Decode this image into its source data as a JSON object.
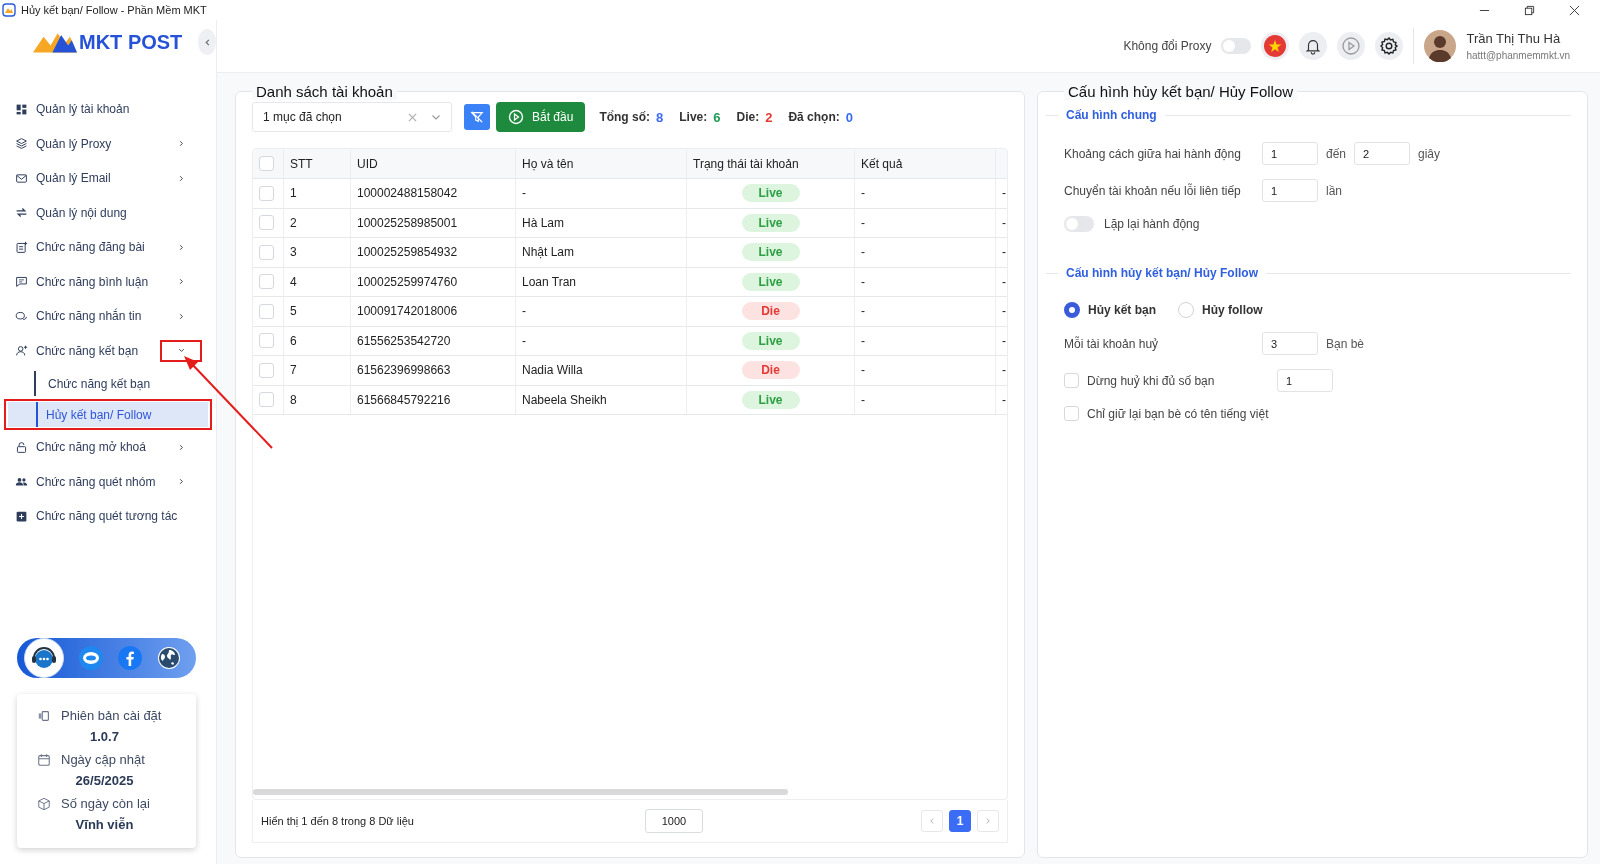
{
  "window": {
    "title": "Hủy kết bạn/ Follow - Phần Mềm MKT"
  },
  "logo": {
    "text": "MKT POST"
  },
  "sidebar": {
    "items": [
      {
        "label": "Quản lý tài khoản",
        "has_submenu": false
      },
      {
        "label": "Quản lý Proxy",
        "has_submenu": true,
        "expanded": false
      },
      {
        "label": "Quản lý Email",
        "has_submenu": true,
        "expanded": false
      },
      {
        "label": "Quản lý nội dung",
        "has_submenu": false
      },
      {
        "label": "Chức năng đăng bài",
        "has_submenu": true,
        "expanded": false
      },
      {
        "label": "Chức năng bình luận",
        "has_submenu": true,
        "expanded": false
      },
      {
        "label": "Chức năng nhắn tin",
        "has_submenu": true,
        "expanded": false
      },
      {
        "label": "Chức năng kết bạn",
        "has_submenu": true,
        "expanded": true,
        "caret_highlighted": true,
        "children": [
          {
            "label": "Chức năng kết bạn",
            "selected": false,
            "highlighted": false
          },
          {
            "label": "Hủy kết bạn/ Follow",
            "selected": true,
            "highlighted": true
          }
        ]
      },
      {
        "label": "Chức năng mở khoá",
        "has_submenu": true,
        "expanded": false
      },
      {
        "label": "Chức năng quét nhóm",
        "has_submenu": true,
        "expanded": false
      },
      {
        "label": "Chức năng quét tương tác",
        "has_submenu": false
      }
    ]
  },
  "annotation_arrow": true,
  "info_card": {
    "items": [
      {
        "label": "Phiên bản cài đặt",
        "value": "1.0.7"
      },
      {
        "label": "Ngày cập nhật",
        "value": "26/5/2025"
      },
      {
        "label": "Số ngày còn lại",
        "value": "Vĩnh viễn"
      }
    ]
  },
  "header": {
    "proxy_toggle": {
      "label": "Không đổi Proxy",
      "on": false
    },
    "user": {
      "name": "Trần Thị Thu Hà",
      "email": "hattt@phanmemmkt.vn"
    }
  },
  "accounts_panel": {
    "title": "Danh sách tài khoản",
    "select": {
      "value": "1 mục đã chọn"
    },
    "start_button": "Bắt đầu",
    "stats": [
      {
        "label": "Tổng số:",
        "value": "8",
        "color": "#3b6cf6"
      },
      {
        "label": "Live:",
        "value": "6",
        "color": "#1f9d55"
      },
      {
        "label": "Die:",
        "value": "2",
        "color": "#e53935"
      },
      {
        "label": "Đã chọn:",
        "value": "0",
        "color": "#3b6cf6"
      }
    ],
    "table": {
      "all_checked": false,
      "columns": [
        "STT",
        "UID",
        "Họ và tên",
        "Trạng thái tài khoản",
        "Kết quả"
      ],
      "rows": [
        {
          "checked": false,
          "stt": "1",
          "uid": "100002488158042",
          "name": "-",
          "status": "Live",
          "kind": "live",
          "result": "-",
          "column_7": "-"
        },
        {
          "checked": false,
          "stt": "2",
          "uid": "100025258985001",
          "name": "Hà Lam",
          "status": "Live",
          "kind": "live",
          "result": "-",
          "column_7": "-"
        },
        {
          "checked": false,
          "stt": "3",
          "uid": "100025259854932",
          "name": "Nhật Lam",
          "status": "Live",
          "kind": "live",
          "result": "-",
          "column_7": "-"
        },
        {
          "checked": false,
          "stt": "4",
          "uid": "100025259974760",
          "name": "Loan Tran",
          "status": "Live",
          "kind": "live",
          "result": "-",
          "column_7": "-"
        },
        {
          "checked": false,
          "stt": "5",
          "uid": "100091742018006",
          "name": "-",
          "status": "Die",
          "kind": "die",
          "result": "-",
          "column_7": "-"
        },
        {
          "checked": false,
          "stt": "6",
          "uid": "61556253542720",
          "name": "-",
          "status": "Live",
          "kind": "live",
          "result": "-",
          "column_7": "-"
        },
        {
          "checked": false,
          "stt": "7",
          "uid": "61562396998663",
          "name": "Nadia Willa",
          "status": "Die",
          "kind": "die",
          "result": "-",
          "column_7": "-"
        },
        {
          "checked": false,
          "stt": "8",
          "uid": "61566845792216",
          "name": "Nabeela Sheikh",
          "status": "Live",
          "kind": "live",
          "result": "-",
          "column_7": "-"
        }
      ]
    },
    "footer": {
      "summary": "Hiển thị 1 đến 8 trong 8 Dữ liệu",
      "page_size": "1000",
      "pages": [
        {
          "label": "1",
          "selected": true
        }
      ]
    }
  },
  "config_panel": {
    "title": "Cấu hình hủy kết bạn/ Hủy Follow",
    "general": {
      "title": "Cấu hình chung",
      "delay": {
        "label": "Khoảng cách giữa hai hành động",
        "from": "1",
        "joiner": "đến",
        "to": "2",
        "unit": "giây"
      },
      "switch_after": {
        "label": "Chuyển tài khoản nếu lỗi liên tiếp",
        "value": "1",
        "unit": "lần"
      },
      "repeat": {
        "label": "Lặp lại hành động",
        "on": false
      }
    },
    "unfriend": {
      "title": "Cấu hình hủy kết bạn/ Hủy Follow",
      "modes": [
        {
          "label": "Hủy kết bạn",
          "selected": true
        },
        {
          "label": "Hủy follow",
          "selected": false
        }
      ],
      "per_account": {
        "label": "Mỗi tài khoản huỷ",
        "value": "3",
        "unit": "Bạn bè"
      },
      "stop_when": {
        "label": "Dừng huỷ khi đủ số bạn",
        "checked": false,
        "value": "1"
      },
      "keep_vietnamese": {
        "label": "Chỉ giữ lại bạn bè có tên tiếng việt",
        "checked": false
      }
    }
  }
}
